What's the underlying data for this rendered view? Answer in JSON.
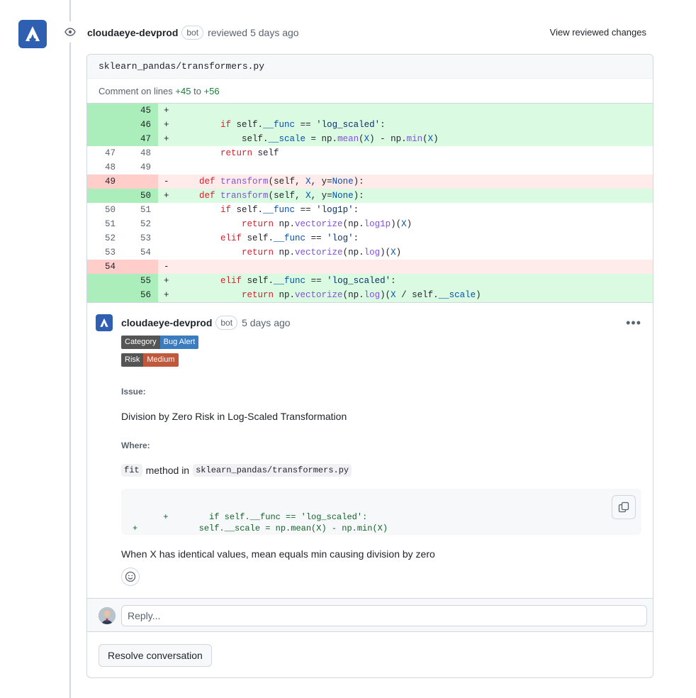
{
  "review": {
    "author": "cloudaeye-devprod",
    "bot_label": "bot",
    "action": "reviewed",
    "time": "5 days ago",
    "view_changes_label": "View reviewed changes"
  },
  "file": {
    "path": "sklearn_pandas/transformers.py",
    "comment_on_prefix": "Comment on lines",
    "line_start": "+45",
    "to_word": "to",
    "line_end": "+56"
  },
  "diff_lines": [
    {
      "type": "add",
      "old": "",
      "new": "45",
      "marker": "+",
      "code": ""
    },
    {
      "type": "add",
      "old": "",
      "new": "46",
      "marker": "+",
      "code": "        if self.__func == 'log_scaled':"
    },
    {
      "type": "add",
      "old": "",
      "new": "47",
      "marker": "+",
      "code": "            self.__scale = np.mean(X) - np.min(X)"
    },
    {
      "type": "ctx",
      "old": "47",
      "new": "48",
      "marker": "",
      "code": "        return self"
    },
    {
      "type": "ctx",
      "old": "48",
      "new": "49",
      "marker": "",
      "code": ""
    },
    {
      "type": "del",
      "old": "49",
      "new": "",
      "marker": "-",
      "code": "    def transform(self, X, y=None):"
    },
    {
      "type": "add",
      "old": "",
      "new": "50",
      "marker": "+",
      "code": "    def transform(self, X, y=None):"
    },
    {
      "type": "ctx",
      "old": "50",
      "new": "51",
      "marker": "",
      "code": "        if self.__func == 'log1p':"
    },
    {
      "type": "ctx",
      "old": "51",
      "new": "52",
      "marker": "",
      "code": "            return np.vectorize(np.log1p)(X)"
    },
    {
      "type": "ctx",
      "old": "52",
      "new": "53",
      "marker": "",
      "code": "        elif self.__func == 'log':"
    },
    {
      "type": "ctx",
      "old": "53",
      "new": "54",
      "marker": "",
      "code": "            return np.vectorize(np.log)(X)"
    },
    {
      "type": "del",
      "old": "54",
      "new": "",
      "marker": "-",
      "code": ""
    },
    {
      "type": "add",
      "old": "",
      "new": "55",
      "marker": "+",
      "code": "        elif self.__func == 'log_scaled':"
    },
    {
      "type": "add",
      "old": "",
      "new": "56",
      "marker": "+",
      "code": "            return np.vectorize(np.log)(X / self.__scale)"
    }
  ],
  "comment": {
    "author": "cloudaeye-devprod",
    "bot_label": "bot",
    "time": "5 days ago",
    "labels": [
      {
        "key": "Category",
        "value": "Bug Alert",
        "color": "#3b7bbf"
      },
      {
        "key": "Risk",
        "value": "Medium",
        "color": "#c0583b"
      }
    ],
    "issue_label": "Issue:",
    "issue_text": "Division by Zero Risk in Log-Scaled Transformation",
    "where_label": "Where:",
    "where_code_1": "fit",
    "where_middle": "method in",
    "where_code_2": "sklearn_pandas/transformers.py",
    "code_block": "+        if self.__func == 'log_scaled':\n+            self.__scale = np.mean(X) - np.min(X)",
    "explanation": "When X has identical values, mean equals min causing division by zero"
  },
  "reply": {
    "placeholder": "Reply..."
  },
  "resolve_label": "Resolve conversation",
  "icons": {
    "eye": "eye-icon",
    "copy": "copy-icon",
    "smiley": "smiley-icon",
    "kebab": "kebab-horizontal-icon"
  }
}
